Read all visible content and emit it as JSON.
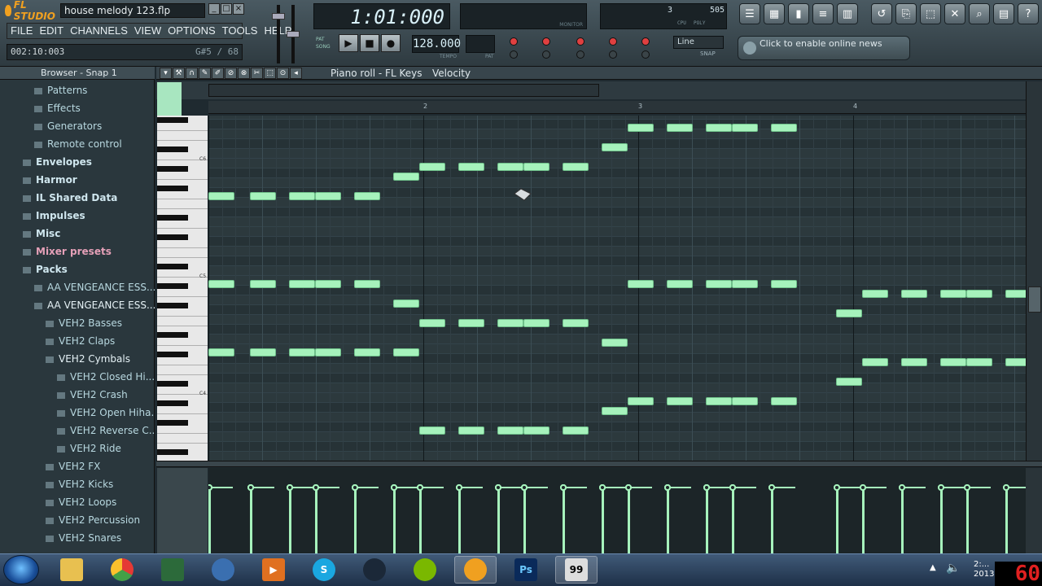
{
  "app": {
    "brand": "FL STUDIO",
    "project_title": "house melody 123.flp",
    "window_controls": [
      "_",
      "□",
      "×"
    ]
  },
  "menu": [
    "FILE",
    "EDIT",
    "CHANNELS",
    "VIEW",
    "OPTIONS",
    "TOOLS",
    "HELP"
  ],
  "hint": {
    "time": "002:10:003",
    "note": "G#5 / 68"
  },
  "lcd": {
    "song_position": "1:01:000",
    "monitor_label": "MONITOR"
  },
  "cpu": {
    "num1": "3",
    "num2": "505",
    "cpu_label": "CPU",
    "poly_label": "POLY"
  },
  "transport": {
    "pat": "PAT",
    "song": "SONG",
    "tempo": "128.000",
    "tempo_label": "TEMPO",
    "pat_label": "PAT"
  },
  "snap": {
    "value": "Line",
    "label": "SNAP"
  },
  "news": {
    "text": "Click to enable online news"
  },
  "browser": {
    "title": "Browser - Snap 1",
    "items": [
      {
        "label": "Patterns",
        "indent": 1
      },
      {
        "label": "Effects",
        "indent": 1
      },
      {
        "label": "Generators",
        "indent": 1
      },
      {
        "label": "Remote control",
        "indent": 1
      },
      {
        "label": "Envelopes",
        "indent": 0
      },
      {
        "label": "Harmor",
        "indent": 0
      },
      {
        "label": "IL Shared Data",
        "indent": 0
      },
      {
        "label": "Impulses",
        "indent": 0
      },
      {
        "label": "Misc",
        "indent": 0
      },
      {
        "label": "Mixer presets",
        "indent": 0
      },
      {
        "label": "Packs",
        "indent": 0
      },
      {
        "label": "AA VENGEANCE ESS...",
        "indent": 1
      },
      {
        "label": "AA VENGEANCE ESS...",
        "indent": 1
      },
      {
        "label": "VEH2 Basses",
        "indent": 2
      },
      {
        "label": "VEH2 Claps",
        "indent": 2
      },
      {
        "label": "VEH2 Cymbals",
        "indent": 2
      },
      {
        "label": "VEH2 Closed Hi...",
        "indent": 3
      },
      {
        "label": "VEH2 Crash",
        "indent": 3
      },
      {
        "label": "VEH2 Open Hiha...",
        "indent": 3
      },
      {
        "label": "VEH2 Reverse C...",
        "indent": 3
      },
      {
        "label": "VEH2 Ride",
        "indent": 3
      },
      {
        "label": "VEH2 FX",
        "indent": 2
      },
      {
        "label": "VEH2 Kicks",
        "indent": 2
      },
      {
        "label": "VEH2 Loops",
        "indent": 2
      },
      {
        "label": "VEH2 Percussion",
        "indent": 2
      },
      {
        "label": "VEH2 Snares",
        "indent": 2
      }
    ]
  },
  "piano_roll": {
    "title": "Piano roll - FL Keys",
    "target": "Velocity",
    "bars": [
      "2",
      "3",
      "4"
    ],
    "octave_labels": [
      "C6",
      "C5",
      "C4"
    ]
  },
  "notes": [
    {
      "row": 17,
      "start": 0,
      "len": 1
    },
    {
      "row": 17,
      "start": 1.6,
      "len": 1
    },
    {
      "row": 17,
      "start": 3.1,
      "len": 1
    },
    {
      "row": 17,
      "start": 4.1,
      "len": 1
    },
    {
      "row": 17,
      "start": 5.6,
      "len": 1
    },
    {
      "row": 15,
      "start": 7.1,
      "len": 1
    },
    {
      "row": 14,
      "start": 8.1,
      "len": 1
    },
    {
      "row": 14,
      "start": 9.6,
      "len": 1
    },
    {
      "row": 14,
      "start": 11.1,
      "len": 1
    },
    {
      "row": 14,
      "start": 12.1,
      "len": 1
    },
    {
      "row": 14,
      "start": 13.6,
      "len": 1
    },
    {
      "row": 12,
      "start": 15.1,
      "len": 1
    },
    {
      "row": 10,
      "start": 16.1,
      "len": 1
    },
    {
      "row": 10,
      "start": 17.6,
      "len": 1
    },
    {
      "row": 10,
      "start": 19.1,
      "len": 1
    },
    {
      "row": 10,
      "start": 20.1,
      "len": 1
    },
    {
      "row": 10,
      "start": 21.6,
      "len": 1
    },
    {
      "row": 29,
      "start": 24.1,
      "len": 1
    },
    {
      "row": 27,
      "start": 25.1,
      "len": 1
    },
    {
      "row": 27,
      "start": 26.6,
      "len": 1
    },
    {
      "row": 27,
      "start": 28.1,
      "len": 1
    },
    {
      "row": 27,
      "start": 29.1,
      "len": 1
    },
    {
      "row": 27,
      "start": 30.6,
      "len": 1
    },
    {
      "row": 26,
      "start": 0,
      "len": 1
    },
    {
      "row": 26,
      "start": 1.6,
      "len": 1
    },
    {
      "row": 26,
      "start": 3.1,
      "len": 1
    },
    {
      "row": 26,
      "start": 4.1,
      "len": 1
    },
    {
      "row": 26,
      "start": 5.6,
      "len": 1
    },
    {
      "row": 28,
      "start": 7.1,
      "len": 1
    },
    {
      "row": 30,
      "start": 8.1,
      "len": 1
    },
    {
      "row": 30,
      "start": 9.6,
      "len": 1
    },
    {
      "row": 30,
      "start": 11.1,
      "len": 1
    },
    {
      "row": 30,
      "start": 12.1,
      "len": 1
    },
    {
      "row": 30,
      "start": 13.6,
      "len": 1
    },
    {
      "row": 32,
      "start": 15.1,
      "len": 1
    },
    {
      "row": 26,
      "start": 16.1,
      "len": 1
    },
    {
      "row": 26,
      "start": 17.6,
      "len": 1
    },
    {
      "row": 26,
      "start": 19.1,
      "len": 1
    },
    {
      "row": 26,
      "start": 20.1,
      "len": 1
    },
    {
      "row": 26,
      "start": 21.6,
      "len": 1
    },
    {
      "row": 33,
      "start": 0,
      "len": 1
    },
    {
      "row": 33,
      "start": 1.6,
      "len": 1
    },
    {
      "row": 33,
      "start": 3.1,
      "len": 1
    },
    {
      "row": 33,
      "start": 4.1,
      "len": 1
    },
    {
      "row": 33,
      "start": 5.6,
      "len": 1
    },
    {
      "row": 33,
      "start": 7.1,
      "len": 1
    },
    {
      "row": 41,
      "start": 8.1,
      "len": 1
    },
    {
      "row": 41,
      "start": 9.6,
      "len": 1
    },
    {
      "row": 41,
      "start": 11.1,
      "len": 1
    },
    {
      "row": 41,
      "start": 12.1,
      "len": 1
    },
    {
      "row": 41,
      "start": 13.6,
      "len": 1
    },
    {
      "row": 39,
      "start": 15.1,
      "len": 1
    },
    {
      "row": 38,
      "start": 16.1,
      "len": 1
    },
    {
      "row": 38,
      "start": 17.6,
      "len": 1
    },
    {
      "row": 38,
      "start": 19.1,
      "len": 1
    },
    {
      "row": 38,
      "start": 20.1,
      "len": 1
    },
    {
      "row": 38,
      "start": 21.6,
      "len": 1
    },
    {
      "row": 36,
      "start": 24.1,
      "len": 1
    },
    {
      "row": 34,
      "start": 25.1,
      "len": 1
    },
    {
      "row": 34,
      "start": 26.6,
      "len": 1
    },
    {
      "row": 34,
      "start": 28.1,
      "len": 1
    },
    {
      "row": 34,
      "start": 29.1,
      "len": 1
    },
    {
      "row": 34,
      "start": 30.6,
      "len": 1
    }
  ],
  "taskbar": {
    "apps": [
      "explorer",
      "chrome",
      "task-manager",
      "thunderbird",
      "media-player",
      "skype",
      "steam",
      "spotify",
      "fl-studio",
      "photoshop",
      "fraps"
    ],
    "tray_time": "2:...",
    "tray_date": "2013",
    "fps": "60"
  }
}
